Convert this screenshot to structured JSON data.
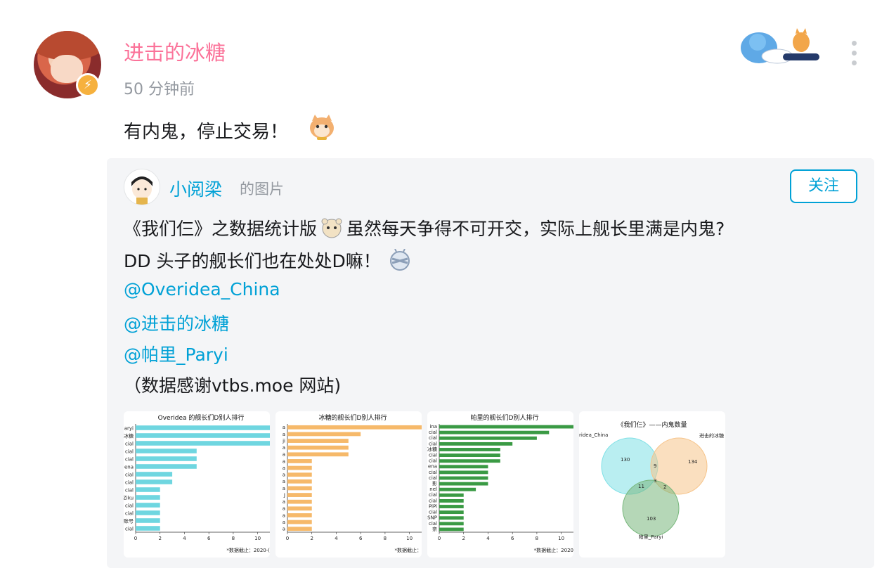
{
  "post": {
    "author": "进击的冰糖",
    "time": "50 分钟前",
    "text": "有内鬼，停止交易！"
  },
  "icons": {
    "badge": "lightning-icon",
    "more": "more-vertical-icon",
    "emoji": "cat-emoji-icon"
  },
  "colors": {
    "pink": "#fb7299",
    "blue": "#00a1d6",
    "grey": "#9499a0",
    "card_bg": "#f4f5f7"
  },
  "repost": {
    "author": "小阅梁",
    "type": "的图片",
    "follow_label": "关注",
    "line1": "《我们仨》之数据统计版",
    "line1b": "虽然每天争得不可开交，实际上舰长里满是内鬼?",
    "line2": "DD 头子的舰长们也在处处D嘛！",
    "mentions": [
      "@Overidea_China",
      "@进击的冰糖",
      "@帕里_Paryi"
    ],
    "footer": "（数据感谢vtbs.moe 网站)"
  },
  "thumbnails": [
    {
      "title": "Overidea 的舰长们D别人排行",
      "note": "*数据截止：2020-("
    },
    {
      "title": "冰糖的舰长们D别人排行",
      "note": "*数据截止："
    },
    {
      "title": "帕里的舰长们D别人排行",
      "note": "*数据截止：2020"
    },
    {
      "title": "《我们仨》——内鬼数量"
    }
  ],
  "chart_data": [
    {
      "type": "bar",
      "title": "Overidea 的舰长们D别人排行",
      "color": "#6fd6e0",
      "categories": [
        "aryi",
        "冰糖",
        "cial",
        "cial",
        "cial",
        "ena",
        "cial",
        "cial",
        "cial",
        "Ziku",
        "cial",
        "cial",
        "账号",
        "cial"
      ],
      "values": [
        11,
        11,
        11,
        5,
        5,
        5,
        3,
        3,
        2,
        2,
        2,
        2,
        2,
        2
      ],
      "xlim": [
        0,
        11
      ],
      "xticks": [
        0,
        2,
        4,
        6,
        8,
        10
      ]
    },
    {
      "type": "bar",
      "title": "冰糖的舰长们D别人排行",
      "color": "#f6b96a",
      "categories": [
        "a",
        "a",
        "ji",
        "a",
        "a",
        "a",
        "a",
        "a",
        "a",
        "a",
        "J",
        "a",
        "a",
        "a",
        "a",
        "a"
      ],
      "values": [
        11,
        6,
        5,
        5,
        5,
        2,
        2,
        2,
        2,
        2,
        2,
        2,
        2,
        2,
        2,
        2
      ],
      "xlim": [
        0,
        11
      ],
      "xticks": [
        0,
        2,
        4,
        6,
        8,
        10
      ]
    },
    {
      "type": "bar",
      "title": "帕里的舰长们D别人排行",
      "color": "#3a9a44",
      "categories": [
        "ina",
        "cial",
        "cial",
        "cial",
        "冰糖",
        "cial",
        "cial",
        "ena",
        "cial",
        "cial",
        "影",
        "nel",
        "cial",
        "cial",
        "PiPi",
        "cial",
        "SNP",
        "cial",
        "奈"
      ],
      "values": [
        11,
        9,
        8,
        6,
        5,
        5,
        5,
        4,
        4,
        4,
        4,
        3,
        2,
        2,
        2,
        2,
        2,
        2,
        2
      ],
      "xlim": [
        0,
        11
      ],
      "xticks": [
        0,
        2,
        4,
        6,
        8,
        10
      ]
    },
    {
      "type": "venn",
      "title": "《我们仨》——内鬼数量",
      "sets": [
        {
          "name": "ridea_China",
          "size": 130,
          "color": "#7fe0e6"
        },
        {
          "name": "进击的冰糖",
          "size": 134,
          "color": "#f6c48a"
        },
        {
          "name": "帕里_Paryi",
          "size": 103,
          "color": "#78b77c"
        }
      ],
      "overlaps": {
        "A∩B": 9,
        "A∩C": 11,
        "B∩C": 2,
        "A∩B∩C": 3
      }
    }
  ]
}
